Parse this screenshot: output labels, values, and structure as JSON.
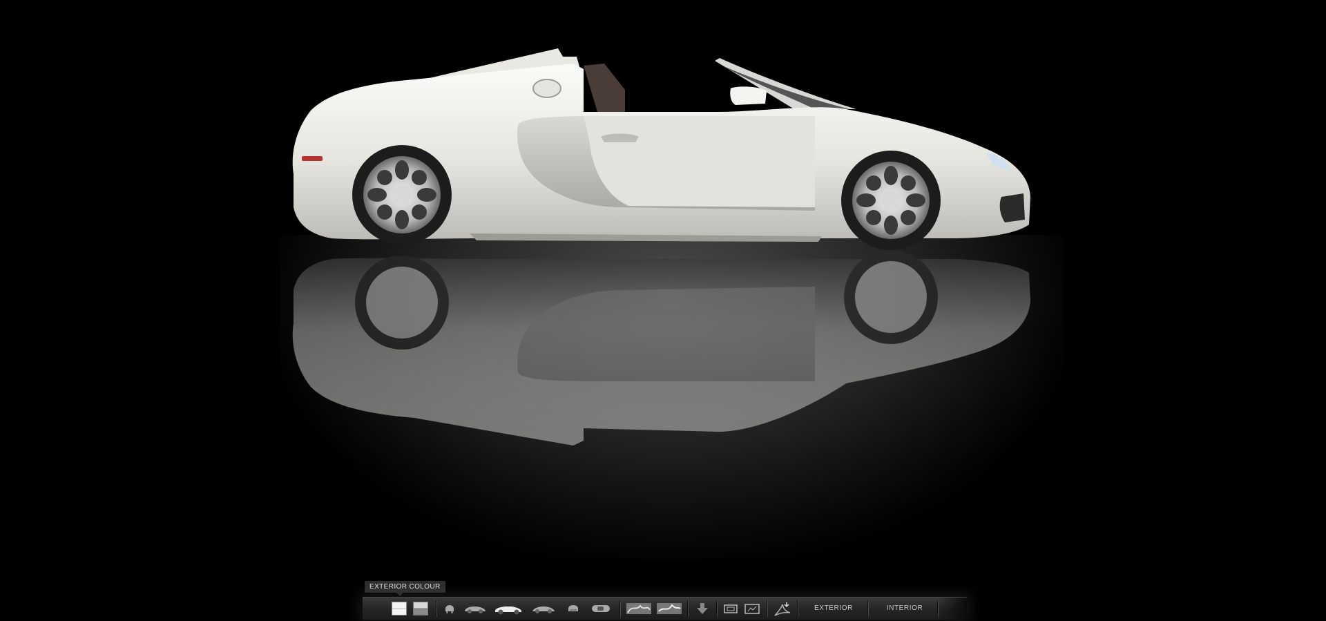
{
  "tooltip": {
    "text": "EXTERIOR COLOUR"
  },
  "toolbar": {
    "exterior_label": "EXTERIOR",
    "interior_label": "INTERIOR",
    "icons": [
      "color-solid-icon",
      "color-two-tone-icon",
      "view-front-icon",
      "view-three-quarter-front-icon",
      "view-side-icon",
      "view-three-quarter-rear-icon",
      "view-rear-icon",
      "view-top-icon",
      "detail-interior-1-icon",
      "detail-interior-2-icon",
      "download-icon",
      "fit-screen-icon",
      "fullscreen-icon",
      "pdf-icon"
    ]
  },
  "colors": {
    "background": "#000000",
    "car_body": "#ecebe6",
    "toolbar": "#2a2a2a",
    "toolbar_text": "#c8c8c8"
  }
}
